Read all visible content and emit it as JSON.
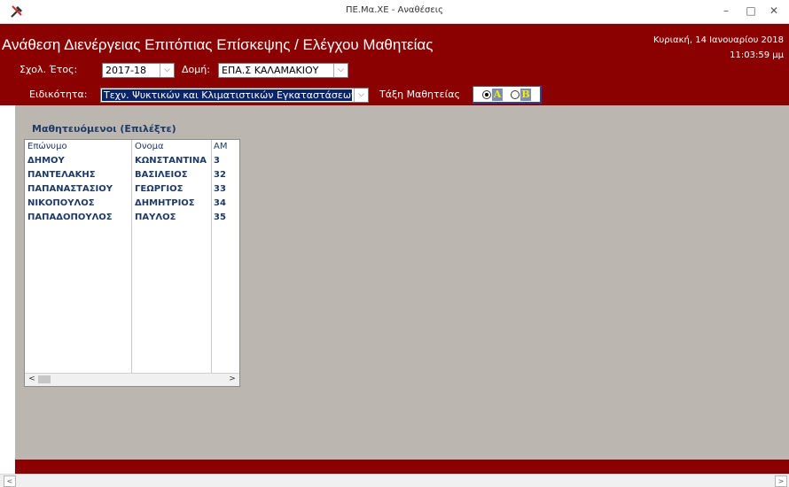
{
  "window": {
    "title": "ΠΕ.Μα.ΧΕ - Αναθέσεις",
    "minimize": "–",
    "maximize": "□",
    "close": "✕"
  },
  "header": {
    "title": "Ανάθεση Διενέργειας Επιτόπιας Επίσκεψης / Ελέγχου Μαθητείας",
    "date": "Κυριακή, 14 Ιανουαρίου 2018",
    "time": "11:03:59 μμ"
  },
  "filters": {
    "school_year_label": "Σχολ. Έτος:",
    "school_year_value": "2017-18",
    "structure_label": "Δομή:",
    "structure_value": "ΕΠΑ.Σ ΚΑΛΑΜΑΚΙΟΥ",
    "specialty_label": "Ειδικότητα:",
    "specialty_value": "Τεχν. Ψυκτικών και Κλιματιστικών Εγκαταστάσεων",
    "class_label": "Τάξη Μαθητείας",
    "class_options": [
      {
        "label": "A",
        "selected": true
      },
      {
        "label": "B",
        "selected": false
      }
    ]
  },
  "apprentices": {
    "title": "Μαθητευόμενοι (Επιλέξτε)",
    "columns": [
      "Επώνυμο",
      "Ονομα",
      "ΑΜ"
    ],
    "rows": [
      [
        "ΔΗΜΟΥ",
        "ΚΩΝΣΤΑΝΤΙΝΑ",
        "3"
      ],
      [
        "ΠΑΝΤΕΛΑΚΗΣ",
        "ΒΑΣΙΛΕΙΟΣ",
        "32"
      ],
      [
        "ΠΑΠΑΝΑΣΤΑΣΙΟΥ",
        "ΓΕΩΡΓΙΟΣ",
        "33"
      ],
      [
        "ΝΙΚΟΠΟΥΛΟΣ",
        "ΔΗΜΗΤΡΙΟΣ",
        "34"
      ],
      [
        "ΠΑΠΑΔΟΠΟΥΛΟΣ",
        "ΠΑΥΛΟΣ",
        "35"
      ]
    ]
  },
  "colors": {
    "header_bg": "#8b0000",
    "content_bg": "#bbb7b0",
    "list_text": "#1f3a68",
    "option_label": "#ffea00"
  },
  "icons": {
    "app": "tools-icon",
    "dropdown": "chevron-down-icon",
    "scroll_left": "arrow-left-icon",
    "scroll_right": "arrow-right-icon"
  },
  "scroll": {
    "left": "<",
    "right": ">",
    "combo_arrow": "⌵"
  }
}
